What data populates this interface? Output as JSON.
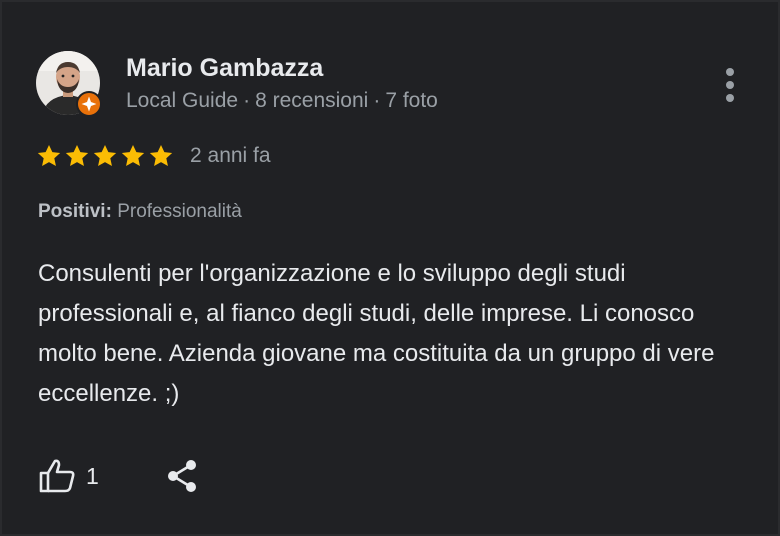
{
  "review": {
    "author": {
      "name": "Mario Gambazza",
      "role": "Local Guide",
      "reviews_count": "8 recensioni",
      "photos_count": "7 foto",
      "separator": "·"
    },
    "rating": 5,
    "date": "2 anni fa",
    "attribute": {
      "label": "Positivi:",
      "value": "Professionalità"
    },
    "text": "Consulenti per l'organizzazione e lo sviluppo degli studi professionali e, al fianco degli studi, delle imprese. Li conosco molto bene. Azienda giovane ma costituita da un gruppo di vere eccellenze. ;)",
    "likes": "1"
  },
  "colors": {
    "background": "#202124",
    "star": "#fbbc04",
    "guide_badge": "#e8710a",
    "text_primary": "#e8eaed",
    "text_secondary": "#9aa0a6"
  },
  "icons": [
    "more-vert-icon",
    "star-icon",
    "thumb-up-icon",
    "share-icon",
    "local-guide-badge-icon"
  ]
}
